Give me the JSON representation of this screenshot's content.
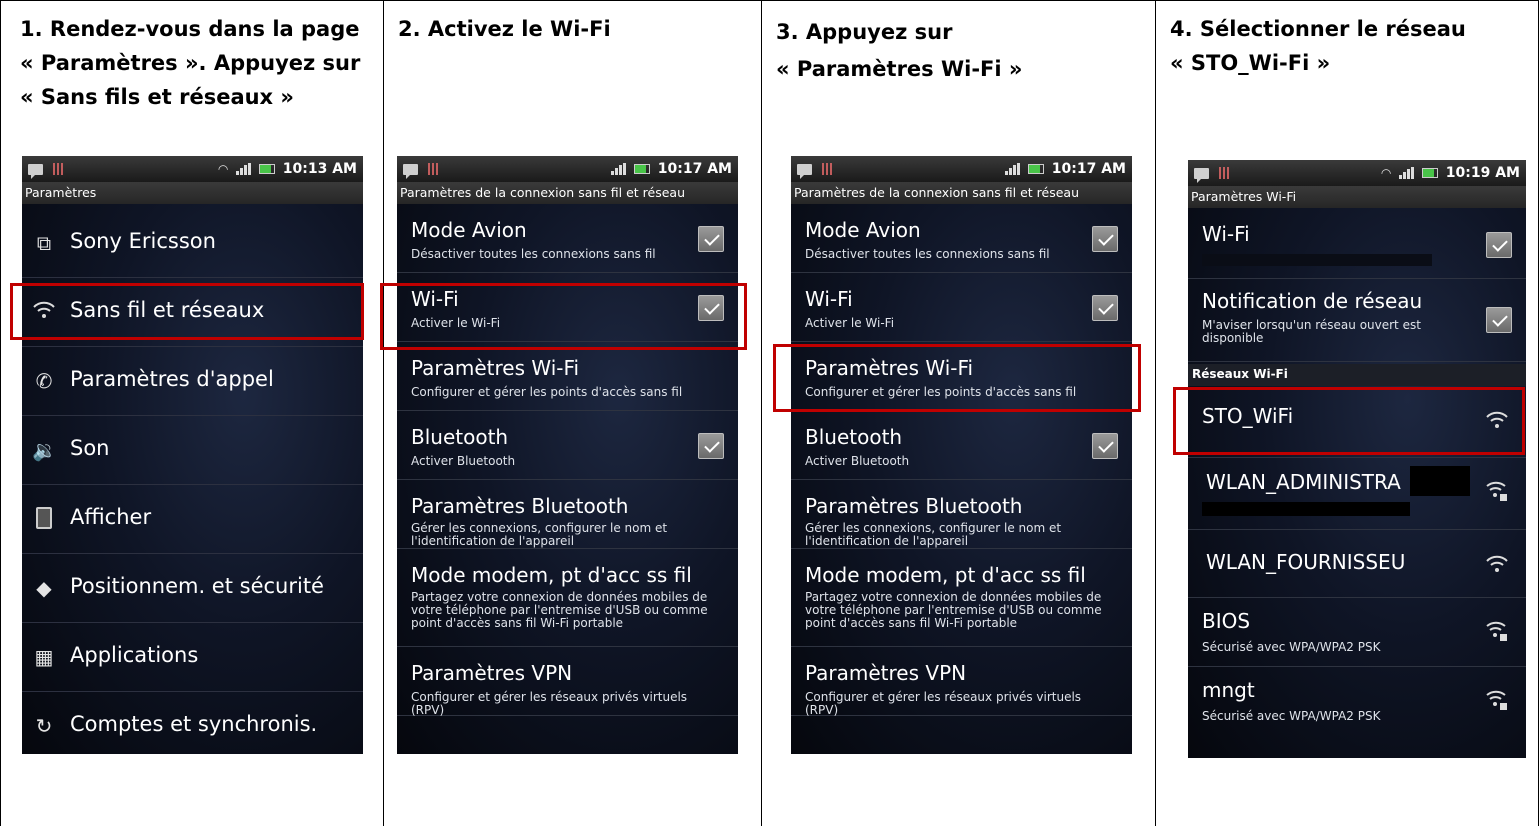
{
  "steps": [
    {
      "title": "1. Rendez-vous dans la page\n« Paramètres ». Appuyez sur\n« Sans fils et réseaux »"
    },
    {
      "title": "2. Activez le Wi-Fi"
    },
    {
      "title": "3. Appuyez sur\n« Paramètres Wi-Fi »"
    },
    {
      "title": "4. Sélectionner le réseau\n« STO_Wi-Fi »"
    }
  ],
  "phone1": {
    "time": "10:13 AM",
    "header": "Paramètres",
    "items": [
      {
        "label": "Sony Ericsson",
        "icon": "device-icon"
      },
      {
        "label": "Sans fil et réseaux",
        "icon": "wifi-icon"
      },
      {
        "label": "Paramètres d'appel",
        "icon": "phone-icon"
      },
      {
        "label": "Son",
        "icon": "speaker-icon"
      },
      {
        "label": "Afficher",
        "icon": "display-icon"
      },
      {
        "label": "Positionnem. et sécurité",
        "icon": "location-icon"
      },
      {
        "label": "Applications",
        "icon": "apps-icon"
      },
      {
        "label": "Comptes et synchronis.",
        "icon": "sync-icon"
      }
    ]
  },
  "wireless": {
    "time": "10:17 AM",
    "header": "Paramètres de la connexion sans fil et réseau",
    "items": [
      {
        "title": "Mode Avion",
        "sub": "Désactiver toutes les connexions sans fil",
        "checkbox": true
      },
      {
        "title": "Wi-Fi",
        "sub": "Activer le Wi-Fi",
        "checkbox": true
      },
      {
        "title": "Paramètres Wi-Fi",
        "sub": "Configurer et gérer les points d'accès sans fil",
        "checkbox": false
      },
      {
        "title": "Bluetooth",
        "sub": "Activer Bluetooth",
        "checkbox": true
      },
      {
        "title": "Paramètres Bluetooth",
        "sub": "Gérer les connexions, configurer le nom et l'identification de l'appareil",
        "checkbox": false
      },
      {
        "title": "Mode modem, pt d'acc ss fil",
        "sub": "Partagez votre connexion de données mobiles de votre téléphone par l'entremise d'USB ou comme point d'accès sans fil Wi-Fi portable",
        "checkbox": false
      },
      {
        "title": "Paramètres VPN",
        "sub": "Configurer et gérer les réseaux privés virtuels (RPV)",
        "checkbox": false
      }
    ]
  },
  "phone4": {
    "time": "10:19 AM",
    "header": "Paramètres Wi-Fi",
    "wifi_title": "Wi-Fi",
    "notif_title": "Notification de réseau",
    "notif_sub": "M'aviser lorsqu'un réseau ouvert est disponible",
    "section": "Réseaux Wi-Fi",
    "networks": [
      {
        "name": "STO_WiFi",
        "sub": "",
        "locked": false
      },
      {
        "name": "WLAN_ADMINISTRA",
        "sub": "",
        "locked": true
      },
      {
        "name": "WLAN_FOURNISSEU",
        "sub": "",
        "locked": false
      },
      {
        "name": "BIOS",
        "sub": "Sécurisé avec WPA/WPA2 PSK",
        "locked": true
      },
      {
        "name": "mngt",
        "sub": "Sécurisé avec WPA/WPA2 PSK",
        "locked": true
      }
    ]
  },
  "colors": {
    "highlight": "#c00000",
    "phone_bg": "#0f1526"
  }
}
